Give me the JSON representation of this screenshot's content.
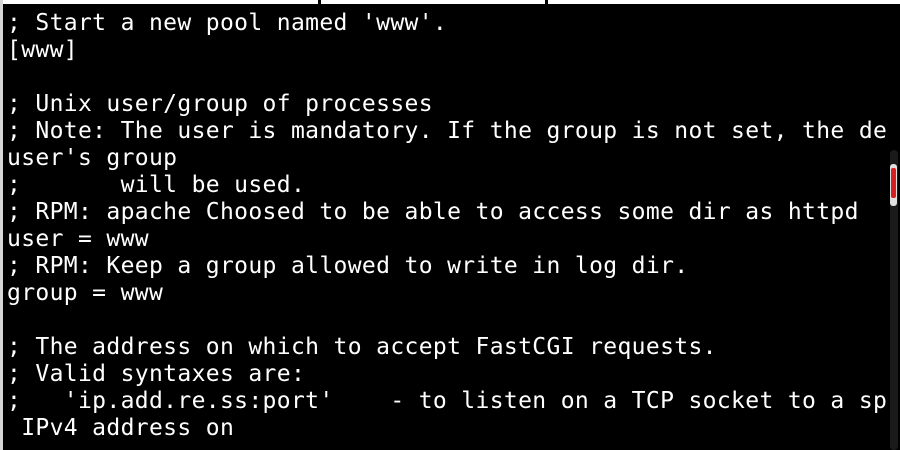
{
  "terminal": {
    "lines": [
      "; Start a new pool named 'www'.",
      "[www]",
      "",
      "; Unix user/group of processes",
      "; Note: The user is mandatory. If the group is not set, the defa",
      "user's group",
      ";       will be used.",
      "; RPM: apache Choosed to be able to access some dir as httpd",
      "user = www",
      "; RPM: Keep a group allowed to write in log dir.",
      "group = www",
      "",
      "; The address on which to accept FastCGI requests.",
      "; Valid syntaxes are:",
      ";   'ip.add.re.ss:port'    - to listen on a TCP socket to a spec",
      " IPv4 address on",
      "                             ,  , ,    ,"
    ]
  },
  "colors": {
    "background": "#000000",
    "text": "#ffffff",
    "scroll_marker": "#d62020"
  }
}
